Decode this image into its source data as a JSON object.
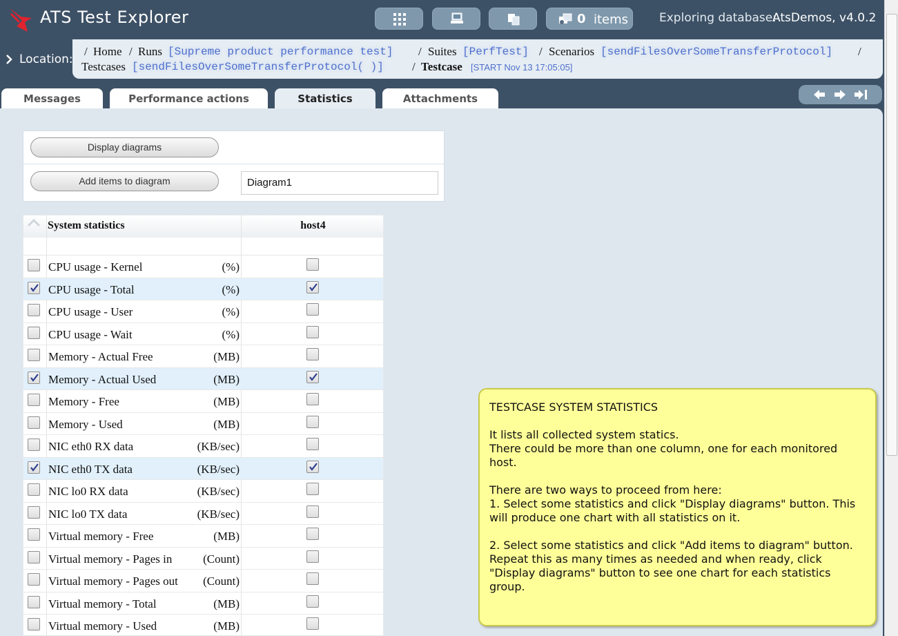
{
  "header": {
    "app_title": "ATS Test Explorer",
    "items_count": "0",
    "items_label": "items",
    "db_label": "Exploring database:",
    "db_name": "AtsDemos, v4.0.2",
    "buttons": [
      "grid-icon",
      "computer-icon",
      "copy-icon",
      "items-icon"
    ]
  },
  "location": {
    "label": "Location:",
    "sep": "/",
    "home": "Home",
    "runs": "Runs",
    "run_name": "[Supreme product performance test]",
    "suites": "Suites",
    "suite_name": "[PerfTest]",
    "scenarios": "Scenarios",
    "scenario_name": "[sendFilesOverSomeTransferProtocol]",
    "testcases": "Testcases",
    "testcase_link": "[sendFilesOverSomeTransferProtocol( )]",
    "testcase": "Testcase",
    "start": "[START Nov 13 17:05:05]"
  },
  "tabs": [
    {
      "label": "Messages"
    },
    {
      "label": "Performance actions"
    },
    {
      "label": "Statistics",
      "active": true
    },
    {
      "label": "Attachments"
    }
  ],
  "controls": {
    "display_diagrams": "Display diagrams",
    "add_items": "Add items to diagram",
    "diagram_name": "Diagram1"
  },
  "table": {
    "header_name": "System statistics",
    "header_host": "host4",
    "rows": [
      {
        "name": "CPU usage - Kernel",
        "unit": "(%)",
        "checked": false
      },
      {
        "name": "CPU usage - Total",
        "unit": "(%)",
        "checked": true
      },
      {
        "name": "CPU usage - User",
        "unit": "(%)",
        "checked": false
      },
      {
        "name": "CPU usage - Wait",
        "unit": "(%)",
        "checked": false
      },
      {
        "name": "Memory - Actual Free",
        "unit": "(MB)",
        "checked": false
      },
      {
        "name": "Memory - Actual Used",
        "unit": "(MB)",
        "checked": true
      },
      {
        "name": "Memory - Free",
        "unit": "(MB)",
        "checked": false
      },
      {
        "name": "Memory - Used",
        "unit": "(MB)",
        "checked": false
      },
      {
        "name": "NIC eth0 RX data",
        "unit": "(KB/sec)",
        "checked": false
      },
      {
        "name": "NIC eth0 TX data",
        "unit": "(KB/sec)",
        "checked": true
      },
      {
        "name": "NIC lo0 RX data",
        "unit": "(KB/sec)",
        "checked": false
      },
      {
        "name": "NIC lo0 TX data",
        "unit": "(KB/sec)",
        "checked": false
      },
      {
        "name": "Virtual memory - Free",
        "unit": "(MB)",
        "checked": false
      },
      {
        "name": "Virtual memory - Pages in",
        "unit": "(Count)",
        "checked": false
      },
      {
        "name": "Virtual memory - Pages out",
        "unit": "(Count)",
        "checked": false
      },
      {
        "name": "Virtual memory - Total",
        "unit": "(MB)",
        "checked": false
      },
      {
        "name": "Virtual memory - Used",
        "unit": "(MB)",
        "checked": false
      }
    ]
  },
  "note": {
    "title": "TESTCASE SYSTEM STATISTICS",
    "p1": "It lists all collected system statics.",
    "p2": "There could be more than one column, one for each monitored host.",
    "p3": "There are two ways to proceed from here:",
    "p4": "1. Select some statistics and click \"Display diagrams\" button. This will produce one chart with all statistics on it.",
    "p5": "2. Select some statistics and click \"Add items to diagram\" button. Repeat this as many times as needed and when ready, click \"Display diagrams\" button to see one chart for each statistics group."
  },
  "colors": {
    "header_bg": "#3d5166",
    "content_bg": "#dfe7ee",
    "link": "#4f70cc",
    "note_bg": "#ffff99",
    "selected_row": "#e1f0fb"
  }
}
